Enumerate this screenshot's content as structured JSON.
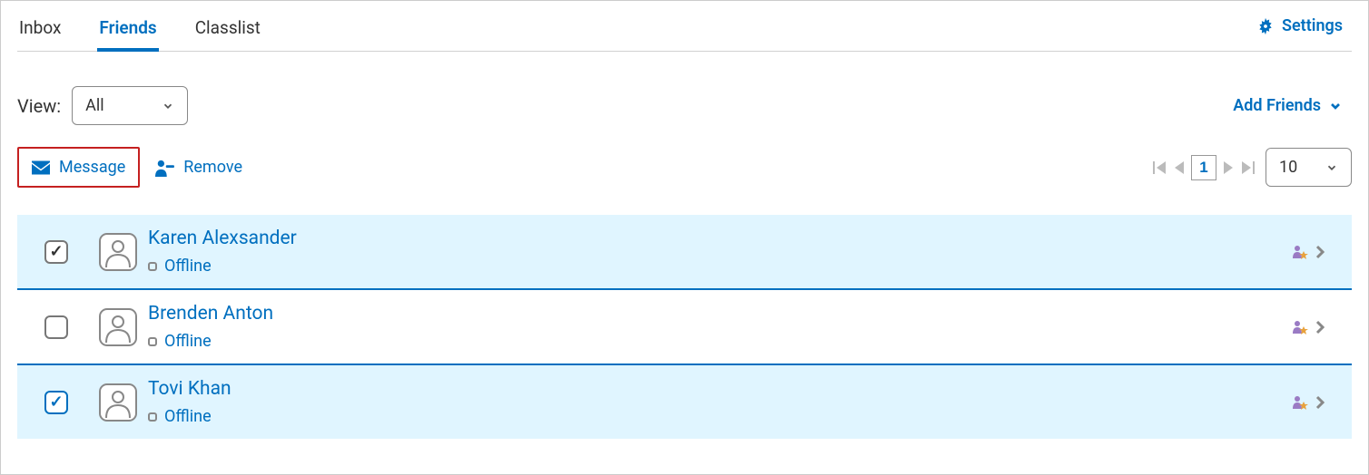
{
  "tabs": {
    "inbox": "Inbox",
    "friends": "Friends",
    "classlist": "Classlist"
  },
  "settings": {
    "label": "Settings"
  },
  "view": {
    "label": "View:",
    "selected": "All"
  },
  "addFriends": {
    "label": "Add Friends"
  },
  "actions": {
    "message": "Message",
    "remove": "Remove"
  },
  "pagination": {
    "page": "1",
    "pageSize": "10"
  },
  "friends": [
    {
      "name": "Karen Alexsander",
      "status": "Offline",
      "selected": true
    },
    {
      "name": "Brenden Anton",
      "status": "Offline",
      "selected": false
    },
    {
      "name": "Tovi Khan",
      "status": "Offline",
      "selected": true
    }
  ]
}
